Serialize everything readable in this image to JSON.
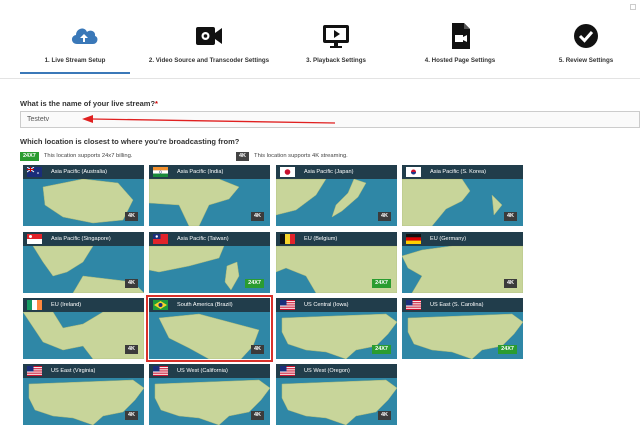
{
  "wizard": {
    "steps": [
      {
        "label": "1. Live Stream Setup",
        "icon": "cloud-upload-icon"
      },
      {
        "label": "2. Video Source and Transcoder Settings",
        "icon": "video-camera-gear-icon"
      },
      {
        "label": "3. Playback Settings",
        "icon": "monitor-play-icon"
      },
      {
        "label": "4. Hosted Page Settings",
        "icon": "document-video-icon"
      },
      {
        "label": "5. Review Settings",
        "icon": "checkmark-circle-icon"
      }
    ],
    "active_color": "#3a78b8"
  },
  "form": {
    "name_question": "What is the name of your live stream?",
    "required_mark": "*",
    "name_value": "Testetv",
    "location_question": "Which location is closest to where you're broadcasting from?"
  },
  "legend": {
    "badge_24x7": "24X7",
    "text_24x7": "This location supports 24x7 billing.",
    "badge_4k": "4K",
    "text_4k": "This location supports 4K streaming."
  },
  "locations": [
    {
      "name": "Asia Pacific (Australia)",
      "badge": "4K",
      "flag": "australia-flag-icon"
    },
    {
      "name": "Asia Pacific (India)",
      "badge": "4K",
      "flag": "india-flag-icon"
    },
    {
      "name": "Asia Pacific (Japan)",
      "badge": "4K",
      "flag": "japan-flag-icon"
    },
    {
      "name": "Asia Pacific (S. Korea)",
      "badge": "4K",
      "flag": "south-korea-flag-icon"
    },
    {
      "name": "Asia Pacific (Singapore)",
      "badge": "4K",
      "flag": "singapore-flag-icon"
    },
    {
      "name": "Asia Pacific (Taiwan)",
      "badge": "24X7",
      "flag": "taiwan-flag-icon"
    },
    {
      "name": "EU (Belgium)",
      "badge": "24X7",
      "flag": "belgium-flag-icon"
    },
    {
      "name": "EU (Germany)",
      "badge": "4K",
      "flag": "germany-flag-icon"
    },
    {
      "name": "EU (Ireland)",
      "badge": "4K",
      "flag": "ireland-flag-icon"
    },
    {
      "name": "South America (Brazil)",
      "badge": "4K",
      "flag": "brazil-flag-icon",
      "selected": true
    },
    {
      "name": "US Central (Iowa)",
      "badge": "24X7",
      "flag": "us-flag-icon"
    },
    {
      "name": "US East (S. Carolina)",
      "badge": "24X7",
      "flag": "us-flag-icon"
    },
    {
      "name": "US East (Virginia)",
      "badge": "4K",
      "flag": "us-flag-icon"
    },
    {
      "name": "US West (California)",
      "badge": "4K",
      "flag": "us-flag-icon"
    },
    {
      "name": "US West (Oregon)",
      "badge": "4K",
      "flag": "us-flag-icon"
    }
  ],
  "colors": {
    "badge_24x7": "#2a9c30",
    "badge_4k": "#3b3b3b",
    "selected_outline": "#d9312b",
    "annotation_arrow": "#e02020"
  }
}
